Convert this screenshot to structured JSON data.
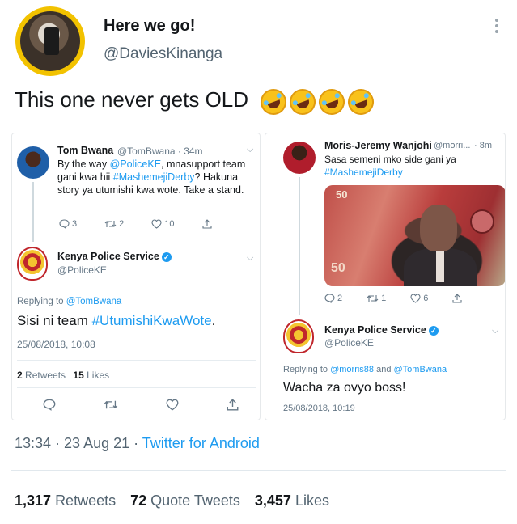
{
  "tweet": {
    "display_name": "Here we go!",
    "handle": "@DaviesKinanga",
    "text": "This one never gets OLD",
    "emoji_icon": "rolling-on-floor-laughing-emoji",
    "emoji_count": 4,
    "timestamp": "13:34 · 23 Aug 21 · ",
    "source": "Twitter for Android",
    "stats": {
      "retweets_count": "1,317",
      "retweets_label": "Retweets",
      "quotes_count": "72",
      "quotes_label": "Quote Tweets",
      "likes_count": "3,457",
      "likes_label": "Likes"
    }
  },
  "left_screenshot": {
    "original": {
      "name": "Tom Bwana",
      "handle_time": "@TomBwana · 34m",
      "text_parts": {
        "p1": "By the way ",
        "mention": "@PoliceKE",
        "p2": ", mnasupport team gani kwa hii ",
        "hashtag": "#MashemejiDerby",
        "p3": "? Hakuna story ya utumishi kwa wote. Take a stand."
      },
      "replies": "3",
      "retweets": "2",
      "likes": "10"
    },
    "reply": {
      "name": "Kenya Police Service",
      "handle": "@PoliceKE",
      "replying_label": "Replying to ",
      "replying_to": "@TomBwana",
      "text_prefix": "Sisi ni team ",
      "hashtag": "#UtumishiKwaWote",
      "text_suffix": ".",
      "date": "25/08/2018, 10:08",
      "retweets_count": "2",
      "retweets_label": "Retweets",
      "likes_count": "15",
      "likes_label": "Likes"
    }
  },
  "right_screenshot": {
    "original": {
      "name": "Moris-Jeremy Wanjohi",
      "handle": "@morri...",
      "time": "· 8m",
      "text": "Sasa semeni mko side gani ya",
      "hashtag": "#MashemejiDerby",
      "replies": "2",
      "retweets": "1",
      "likes": "6"
    },
    "reply": {
      "name": "Kenya Police Service",
      "handle": "@PoliceKE",
      "replying_label": "Replying to ",
      "replying_to_1": "@morris88",
      "and_label": " and ",
      "replying_to_2": "@TomBwana",
      "text": "Wacha za ovyo boss!",
      "date": "25/08/2018, 10:19"
    },
    "banknote": {
      "value_top": "50",
      "value_bottom": "50"
    }
  },
  "colors": {
    "link": "#1d9bf0",
    "muted": "#536471",
    "avatar_ring": "#f2c200"
  }
}
